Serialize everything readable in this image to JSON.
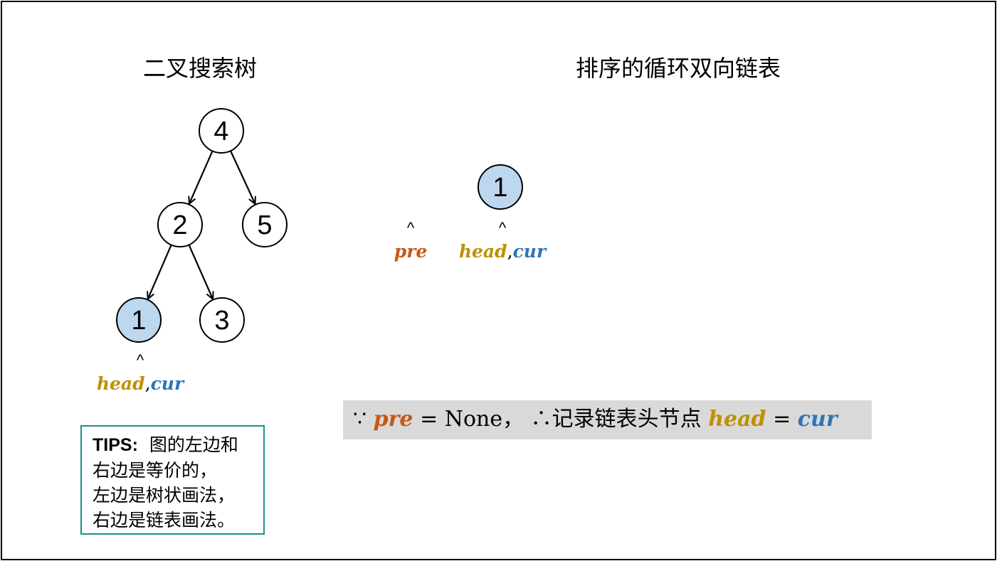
{
  "colors": {
    "pre": "#c55a11",
    "head": "#bf9000",
    "cur": "#2e75b6",
    "node_highlight": "#bdd7ee",
    "tips_border": "#1f8f8a",
    "note_bg": "#d9d9d9"
  },
  "titles": {
    "left": "二叉搜索树",
    "right": "排序的循环双向链表"
  },
  "tree": {
    "nodes": [
      {
        "id": "n4",
        "label": "4",
        "highlight": false
      },
      {
        "id": "n2",
        "label": "2",
        "highlight": false
      },
      {
        "id": "n5",
        "label": "5",
        "highlight": false
      },
      {
        "id": "n1",
        "label": "1",
        "highlight": true
      },
      {
        "id": "n3",
        "label": "3",
        "highlight": false
      }
    ],
    "edges": [
      [
        "n4",
        "n2"
      ],
      [
        "n4",
        "n5"
      ],
      [
        "n2",
        "n1"
      ],
      [
        "n2",
        "n3"
      ]
    ],
    "pointer": {
      "caret": "^",
      "head": "head",
      "sep": ",",
      "cur": "cur"
    }
  },
  "list": {
    "nodes": [
      {
        "id": "l1",
        "label": "1",
        "highlight": true
      }
    ],
    "pre_pointer": {
      "caret": "^",
      "label": "pre"
    },
    "head_pointer": {
      "caret": "^",
      "head": "head",
      "sep": ",",
      "cur": "cur"
    }
  },
  "tips": {
    "prefix": "TIPS:",
    "lines": [
      "图的左边和",
      "右边是等价的，",
      "左边是树状画法，",
      "右边是链表画法。"
    ]
  },
  "note": {
    "because": "∵",
    "pre": "pre",
    "eq1": "= None，",
    "therefore": "∴",
    "text": "记录链表头节点",
    "head": "head",
    "eq2": "=",
    "cur": "cur"
  }
}
